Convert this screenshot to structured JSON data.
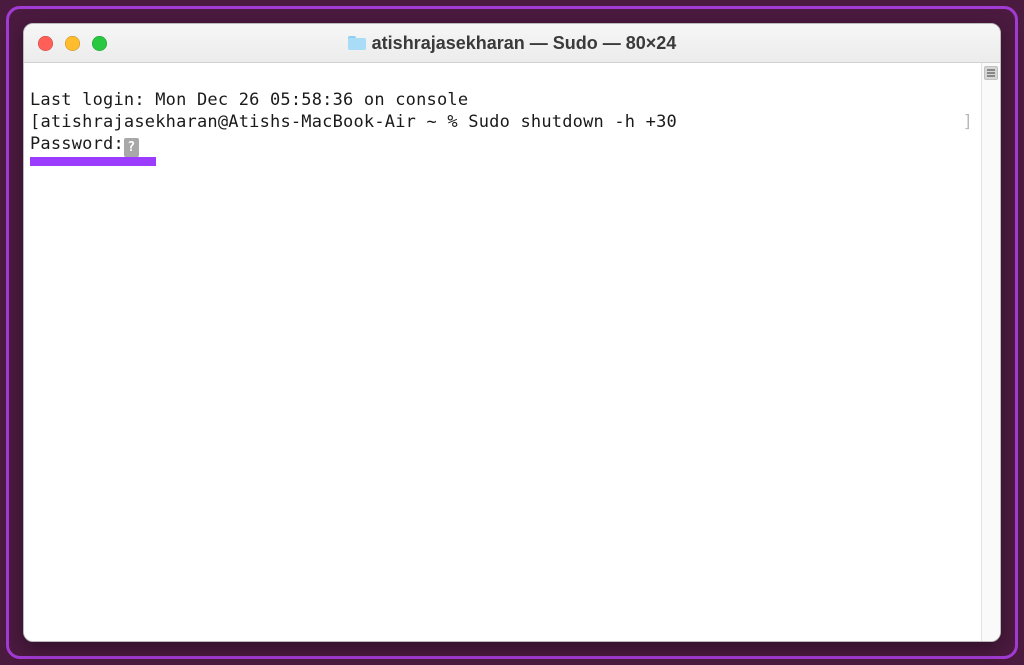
{
  "window": {
    "title": "atishrajasekharan — Sudo — 80×24"
  },
  "terminal": {
    "last_login_line": "Last login: Mon Dec 26 05:58:36 on console",
    "prompt_open_bracket": "[",
    "prompt_user_host": "atishrajasekharan@Atishs-MacBook-Air ~ % ",
    "command": "Sudo shutdown -h +30",
    "prompt_close_bracket": "]",
    "password_label": "Password:",
    "key_glyph_label": "?"
  },
  "colors": {
    "highlight": "#9b3cff",
    "desktop": "#4b1a3f",
    "outline": "#a23bd4"
  }
}
